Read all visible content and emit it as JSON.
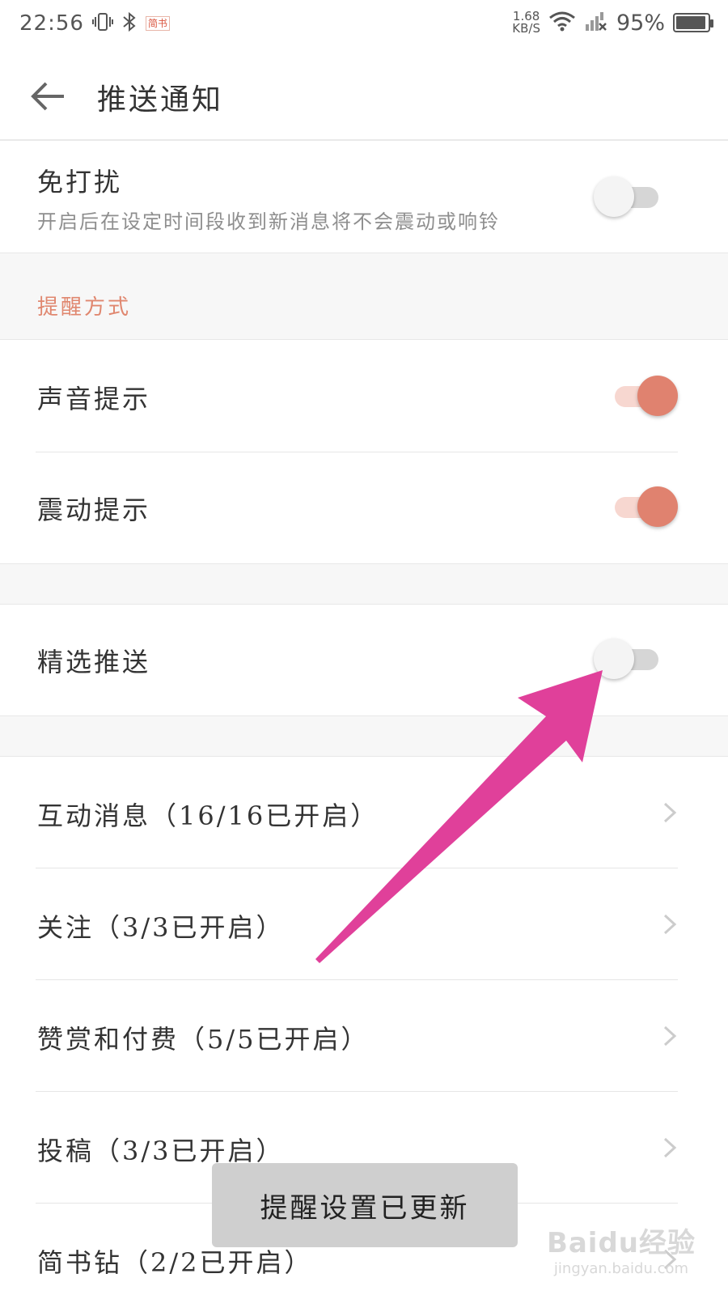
{
  "status_bar": {
    "time": "22:56",
    "app_badge": "简书",
    "net_speed_value": "1.68",
    "net_speed_unit": "KB/S",
    "battery_percent": "95%",
    "battery_level": 0.95
  },
  "header": {
    "title": "推送通知"
  },
  "dnd": {
    "title": "免打扰",
    "subtitle": "开启后在设定时间段收到新消息将不会震动或响铃",
    "enabled": false
  },
  "reminder_section": {
    "label": "提醒方式",
    "items": [
      {
        "label": "声音提示",
        "enabled": true
      },
      {
        "label": "震动提示",
        "enabled": true
      }
    ]
  },
  "featured_push": {
    "label": "精选推送",
    "enabled": false
  },
  "categories": [
    {
      "label": "互动消息（16/16已开启）"
    },
    {
      "label": "关注（3/3已开启）"
    },
    {
      "label": "赞赏和付费（5/5已开启）"
    },
    {
      "label": "投稿（3/3已开启）"
    },
    {
      "label": "简书钻（2/2已开启）"
    }
  ],
  "toast": {
    "message": "提醒设置已更新"
  },
  "watermark": {
    "main": "Baidu经验",
    "sub": "jingyan.baidu.com"
  },
  "colors": {
    "accent": "#e0826f",
    "annotation_arrow": "#e0409a"
  }
}
